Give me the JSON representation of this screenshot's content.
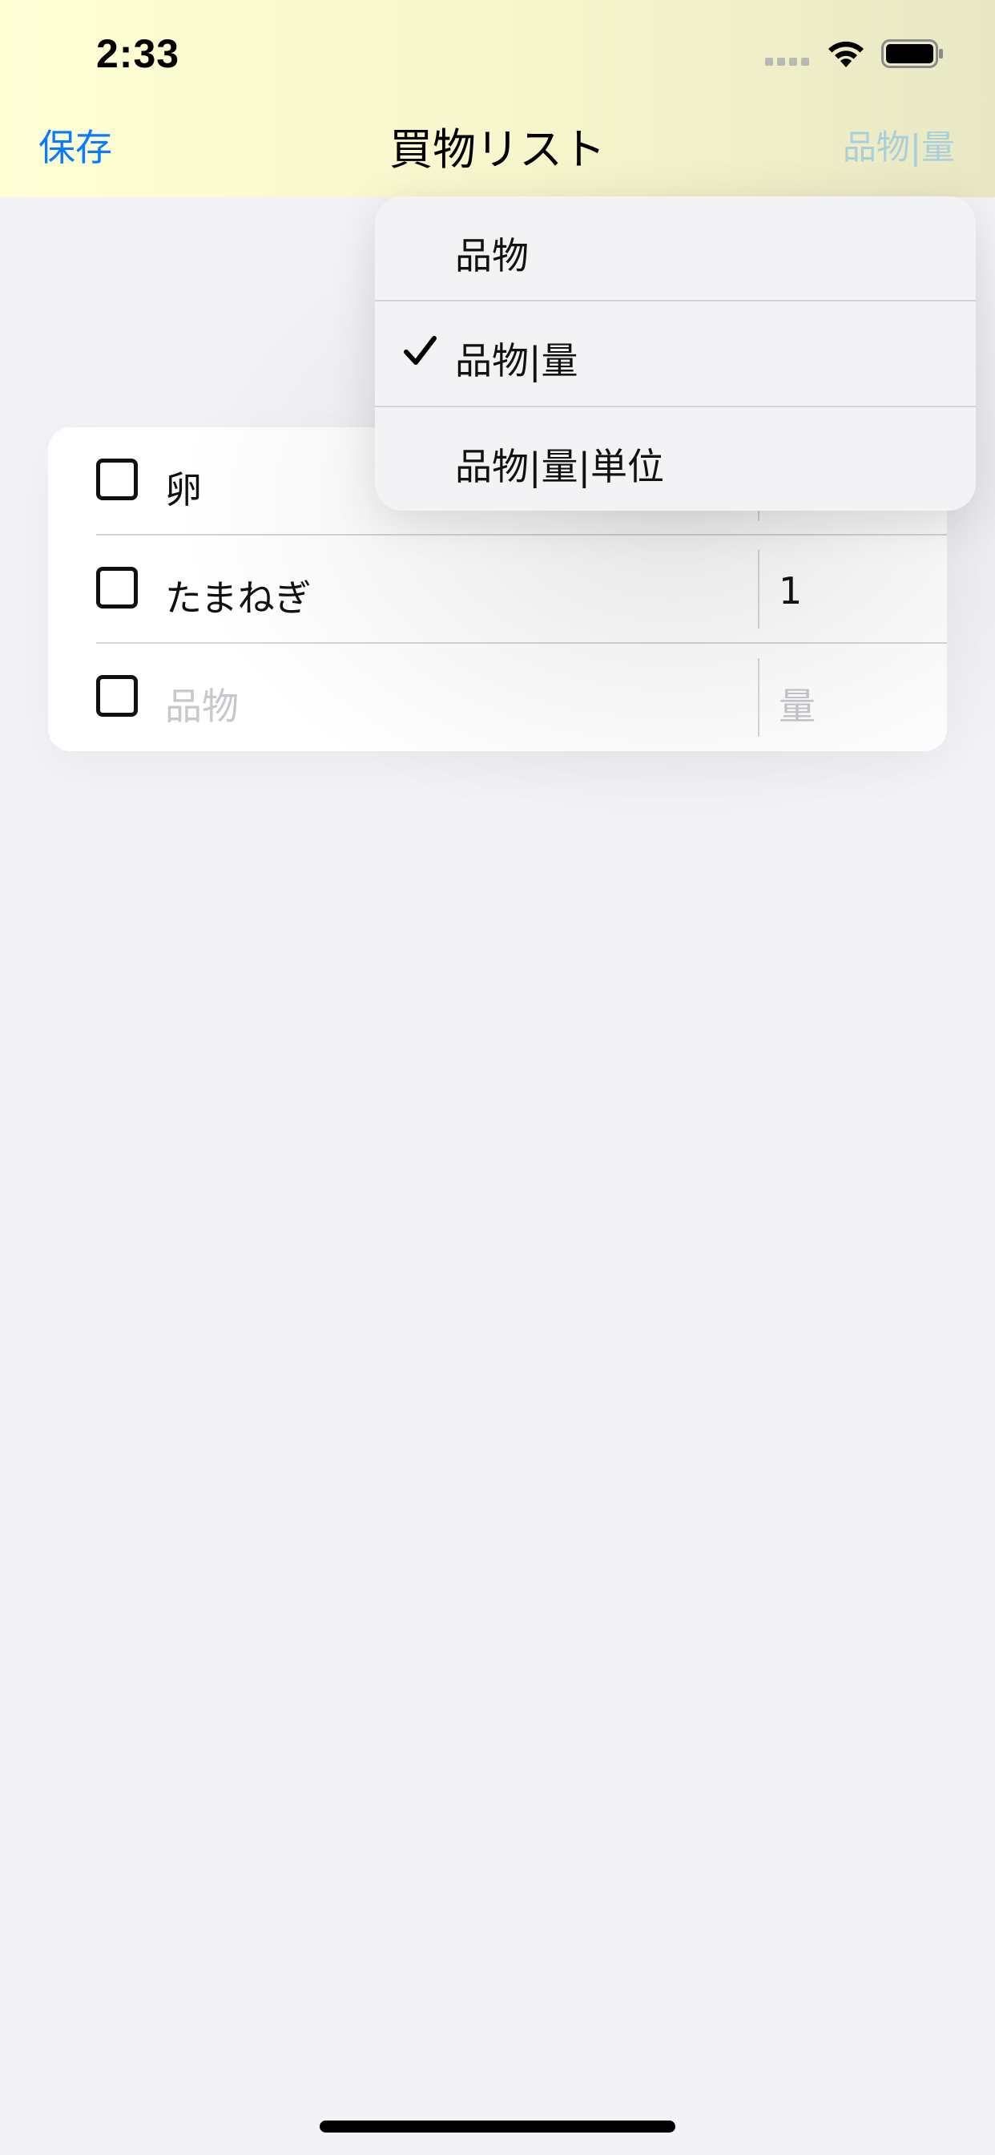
{
  "status_bar": {
    "time": "2:33"
  },
  "nav": {
    "save_label": "保存",
    "title": "買物リスト",
    "mode_label": "品物|量"
  },
  "list": {
    "rows": [
      {
        "item": "卵",
        "qty": ""
      },
      {
        "item": "たまねぎ",
        "qty": "1"
      }
    ],
    "new_row": {
      "item_placeholder": "品物",
      "qty_placeholder": "量"
    }
  },
  "dropdown": {
    "options": [
      {
        "label": "品物",
        "checked": false
      },
      {
        "label": "品物|量",
        "checked": true
      },
      {
        "label": "品物|量|単位",
        "checked": false
      }
    ]
  },
  "colors": {
    "accent": "#0a7aff",
    "nav_background": "#ffffd6",
    "page_background": "#f2f2f7",
    "disabled_nav_item": "#a9cfd9"
  },
  "icons": {
    "wifi": "wifi-icon",
    "battery": "battery-icon",
    "signal": "cellular-signal-icon",
    "check": "checkmark-icon",
    "checkbox": "empty-checkbox-icon"
  }
}
